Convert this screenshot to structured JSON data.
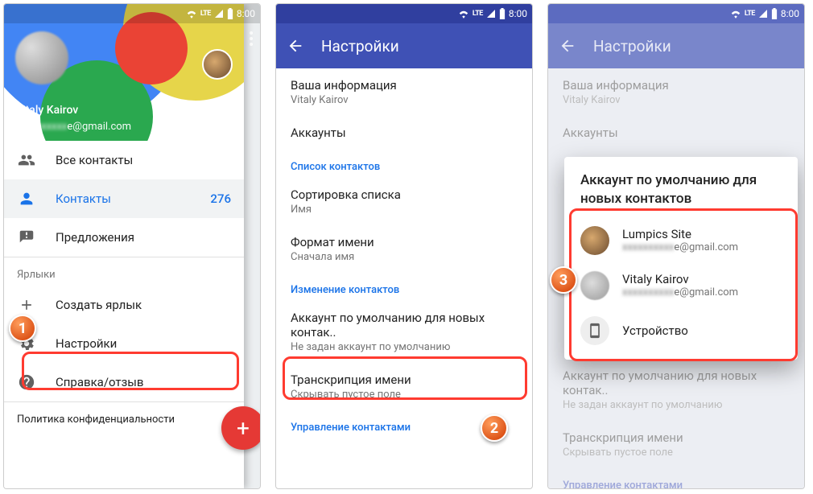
{
  "status": {
    "time": "8:00",
    "lte": "LTE"
  },
  "phone1": {
    "user_name": "Vitaly Kairov",
    "user_email_suffix": "e@gmail.com",
    "nav": {
      "all_contacts": "Все контакты",
      "contacts": "Контакты",
      "contacts_count": "276",
      "suggestions": "Предложения"
    },
    "labels_header": "Ярлыки",
    "create_label": "Создать ярлык",
    "settings": "Настройки",
    "help": "Справка/отзыв",
    "privacy": "Политика конфиденциальности"
  },
  "phone2": {
    "title": "Настройки",
    "your_info": "Ваша информация",
    "your_info_sub": "Vitaly Kairov",
    "accounts": "Аккаунты",
    "contacts_list_hdr": "Список контактов",
    "sort_title": "Сортировка списка",
    "sort_sub": "Имя",
    "name_fmt_title": "Формат имени",
    "name_fmt_sub": "Сначала имя",
    "edit_hdr": "Изменение контактов",
    "default_acc_title": "Аккаунт по умолчанию для новых контак..",
    "default_acc_sub": "Не задан аккаунт по умолчанию",
    "trans_title": "Транскрипция имени",
    "trans_sub": "Скрывать пустое поле",
    "manage_hdr": "Управление контактами"
  },
  "phone3": {
    "title": "Настройки",
    "your_info": "Ваша информация",
    "your_info_sub": "Vitaly Kairov",
    "accounts": "Аккаунты",
    "default_acc_title": "Аккаунт по умолчанию для новых контак..",
    "default_acc_sub": "Не задан аккаунт по умолчанию",
    "trans_title": "Транскрипция имени",
    "trans_sub": "Скрывать пустое поле",
    "manage_hdr": "Управление контактами",
    "dialog": {
      "title": "Аккаунт по умолчанию для новых контактов",
      "opt1_name": "Lumpics Site",
      "opt1_email_suffix": "e@gmail.com",
      "opt2_name": "Vitaly Kairov",
      "opt2_email_suffix": "e@gmail.com",
      "opt3_name": "Устройство"
    }
  },
  "steps": {
    "s1": "1",
    "s2": "2",
    "s3": "3"
  }
}
